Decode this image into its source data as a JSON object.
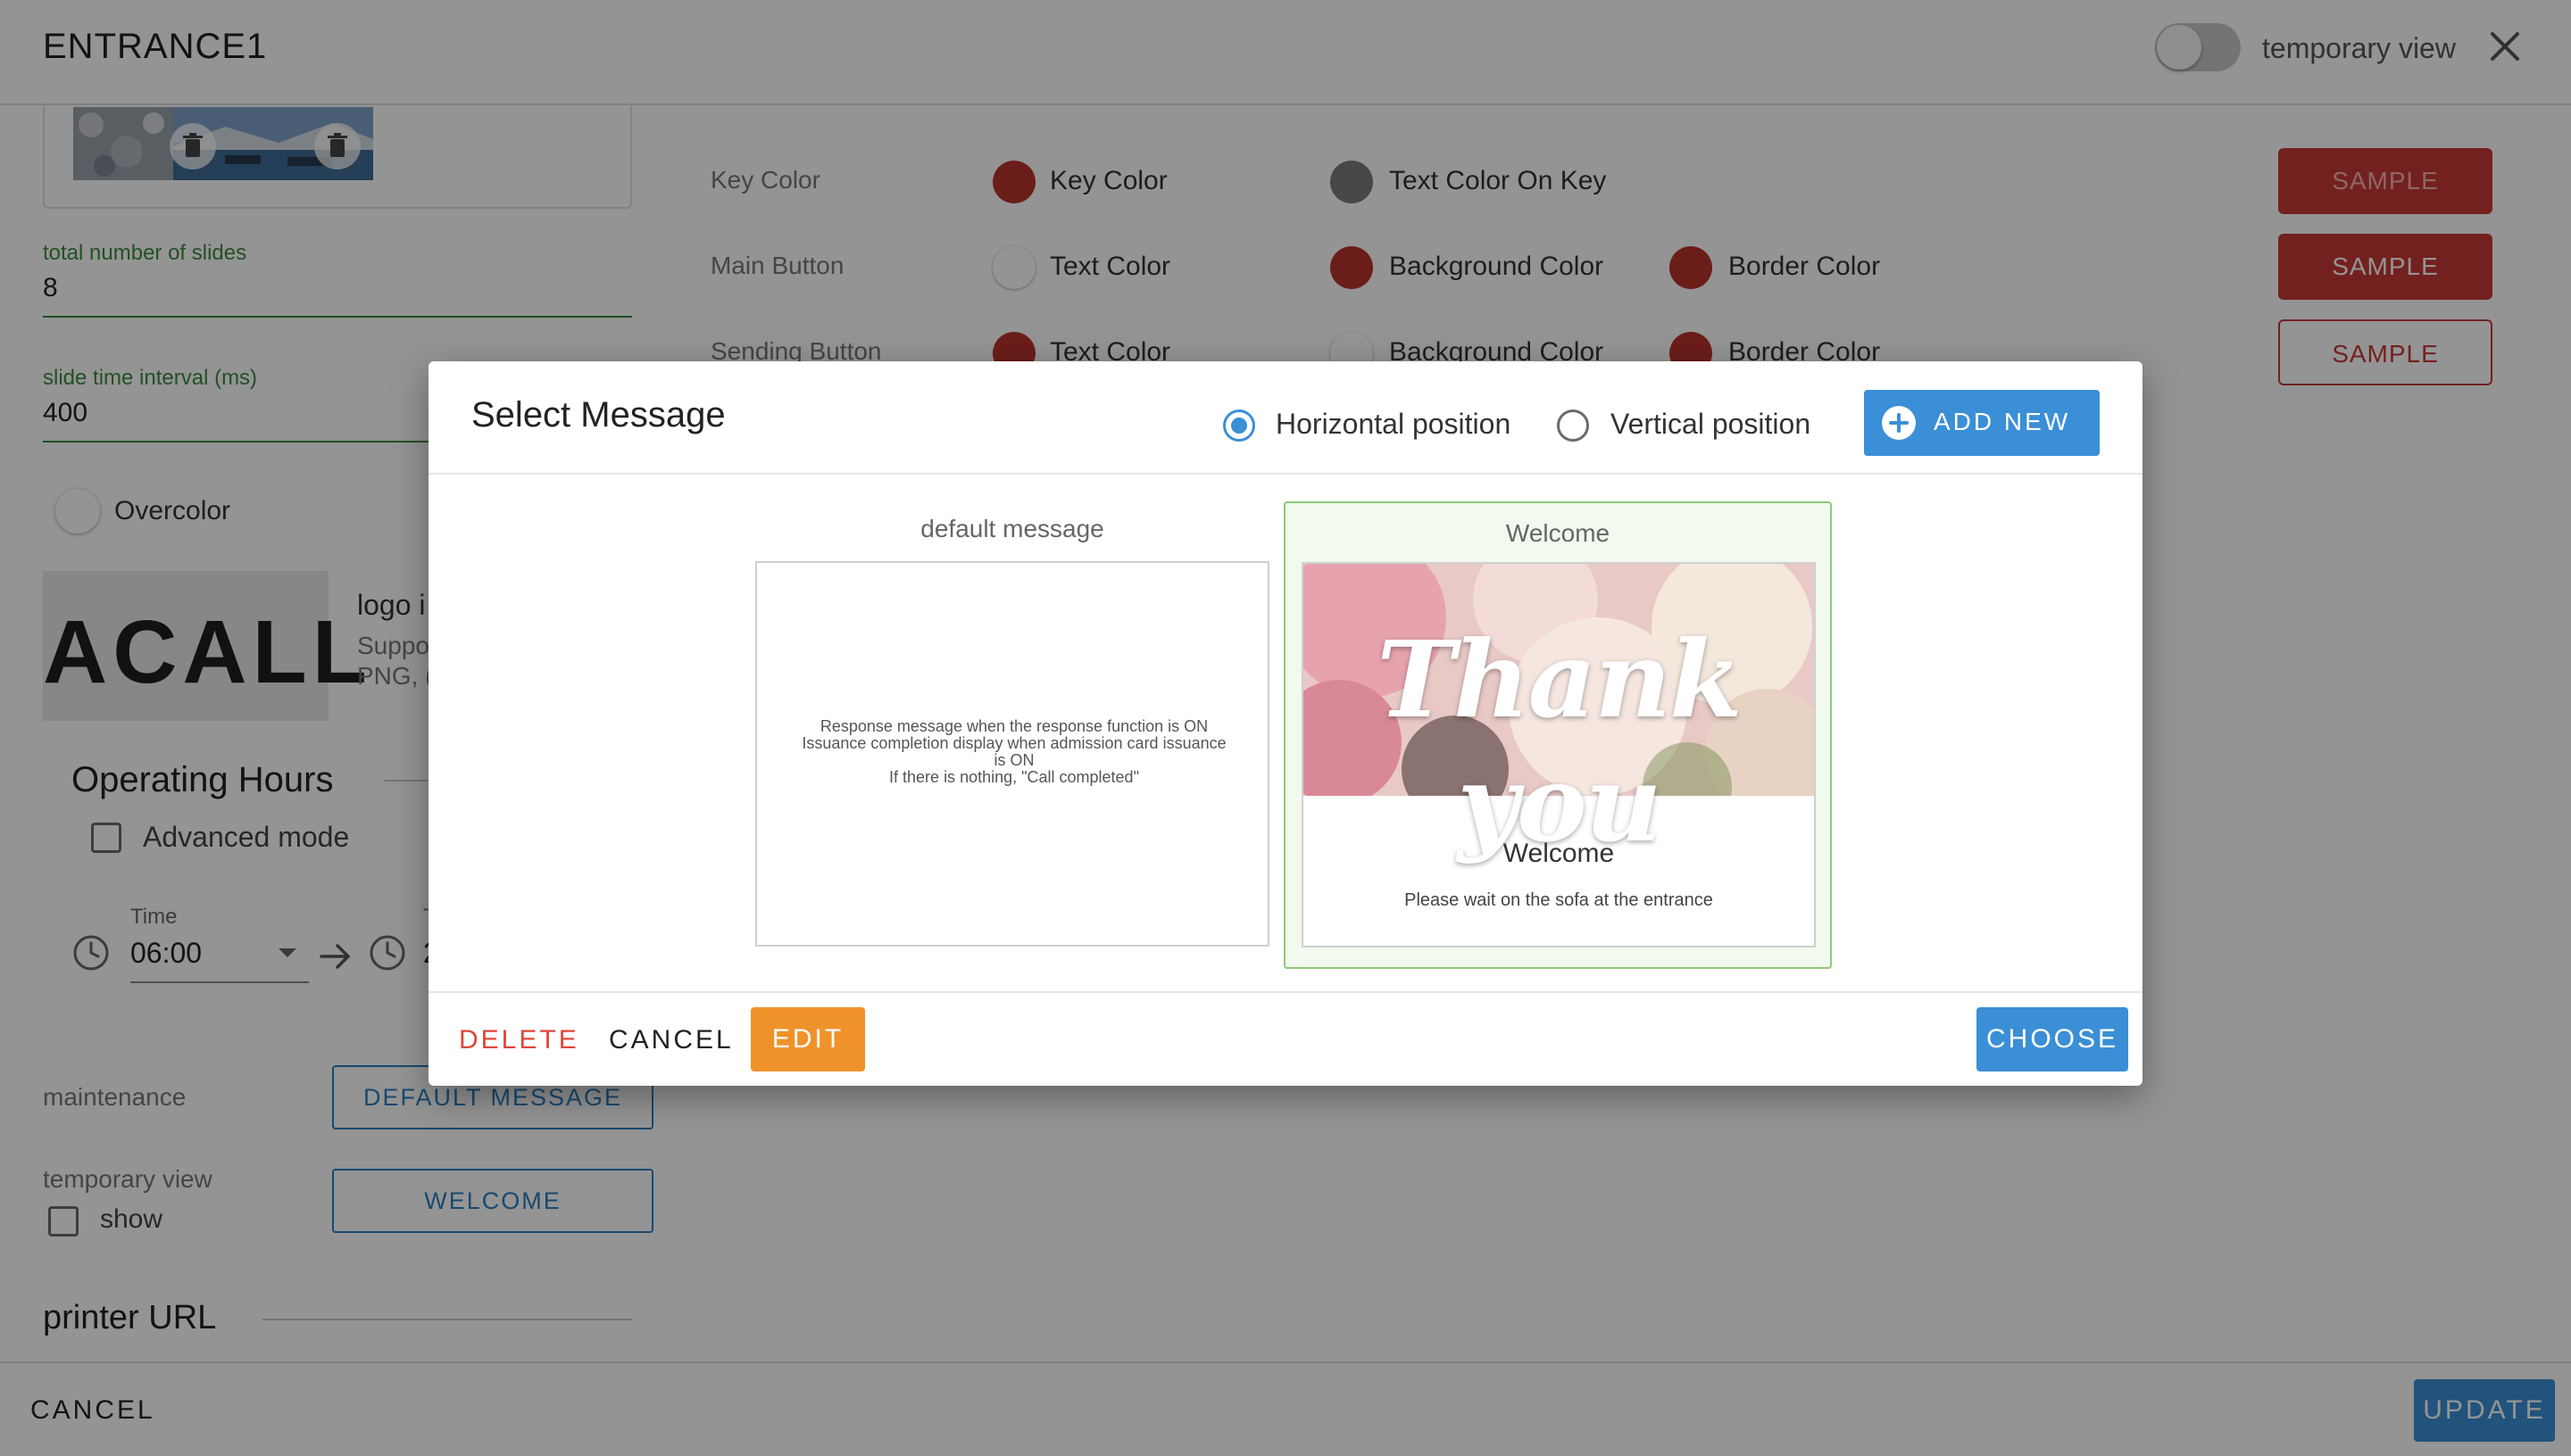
{
  "header": {
    "title": "ENTRANCE1",
    "toggle_label": "temporary view"
  },
  "left_panel": {
    "slides_label": "total number of slides",
    "slides_value": "8",
    "interval_label": "slide time interval (ms)",
    "interval_value": "400",
    "overcolor_label": "Overcolor",
    "logo_text": "ACALL",
    "logo_title_partial": "logo i",
    "logo_desc_line1_partial": "Suppo",
    "logo_desc_line2_partial": "PNG, (",
    "operating_hours": "Operating Hours",
    "advanced_mode": "Advanced mode",
    "time_label": "Time",
    "time_value": "06:00",
    "time_partial_label": "T",
    "time_partial_value": "2",
    "maintenance_label": "maintenance",
    "maintenance_button": "DEFAULT MESSAGE",
    "temp_view_label": "temporary view",
    "show_label": "show",
    "welcome_button": "WELCOME",
    "printer_url": "printer URL"
  },
  "color_settings": {
    "rows": [
      {
        "label": "Key Color",
        "c1": "Key Color",
        "c2": "Text Color On Key",
        "sample": "SAMPLE"
      },
      {
        "label": "Main Button",
        "c1": "Text Color",
        "c2": "Background Color",
        "c3": "Border Color",
        "sample": "SAMPLE"
      },
      {
        "label": "Sending Button",
        "c1": "Text Color",
        "c2": "Background Color",
        "c3": "Border Color",
        "sample": "SAMPLE"
      }
    ],
    "colors": {
      "red": "#b8322e",
      "gray": "#7a7a7a",
      "white": "#ffffff"
    }
  },
  "footer": {
    "cancel": "CANCEL",
    "update": "UPDATE"
  },
  "modal": {
    "title": "Select Message",
    "horizontal": "Horizontal position",
    "vertical": "Vertical position",
    "selected_position": "horizontal",
    "add_new": "ADD NEW",
    "cards": [
      {
        "title": "default message",
        "lines": [
          "Response message when the response function is ON",
          "Issuance completion display when admission card issuance",
          "is ON",
          "If there is nothing, \"Call completed\""
        ]
      },
      {
        "title": "Welcome",
        "image_text": "Thank you",
        "heading": "Welcome",
        "body": "Please wait on the sofa at the entrance",
        "selected": true
      }
    ],
    "buttons": {
      "delete": "DELETE",
      "cancel": "CANCEL",
      "edit": "EDIT",
      "choose": "CHOOSE"
    },
    "colors": {
      "primary": "#3a8fd6",
      "danger": "#e0463a",
      "edit": "#f0922a",
      "selected_border": "#8cc97a"
    }
  }
}
